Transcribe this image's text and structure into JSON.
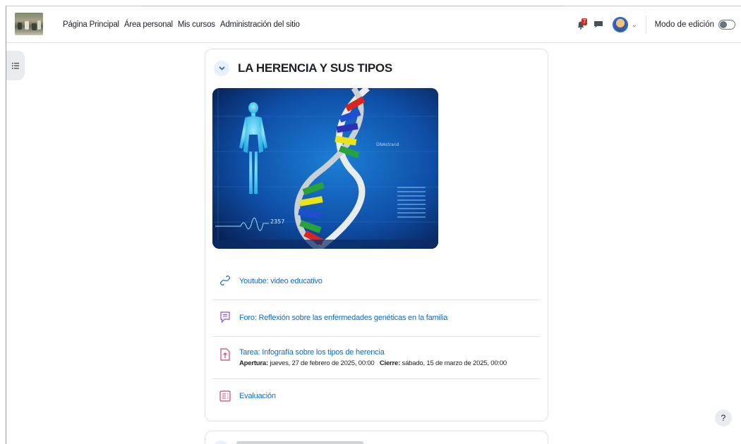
{
  "navbar": {
    "links": [
      "Página Principal",
      "Área personal",
      "Mis cursos",
      "Administración del sitio"
    ],
    "notification_count": "7",
    "edit_mode_label": "Modo de edición"
  },
  "section": {
    "title": "LA HERENCIA Y SUS TIPOS",
    "activities": [
      {
        "type": "url",
        "icon": "link-icon",
        "label": "Youtube: video educativo"
      },
      {
        "type": "forum",
        "icon": "forum-icon",
        "label": "Foro: Reflexión sobre las enfermedades genéticas en la familia"
      },
      {
        "type": "assign",
        "icon": "upload-file-icon",
        "label": "Tarea: Infografía sobre los tipos de herencia",
        "opening_label": "Apertura:",
        "opening_value": "jueves, 27 de febrero de 2025, 00:00",
        "closing_label": "Cierre:",
        "closing_value": "sábado, 15 de marzo de 2025, 00:00"
      },
      {
        "type": "quiz",
        "icon": "quiz-icon",
        "label": "Evaluación"
      }
    ]
  },
  "banner_text": {
    "dna_label": "DNAstrand",
    "wave_number": "2357"
  },
  "help_label": "?",
  "colors": {
    "link": "#0f6cbf",
    "forum": "#8f50c8",
    "assign": "#d0417a",
    "quiz": "#d0417a",
    "accent": "#0f6cbf"
  }
}
